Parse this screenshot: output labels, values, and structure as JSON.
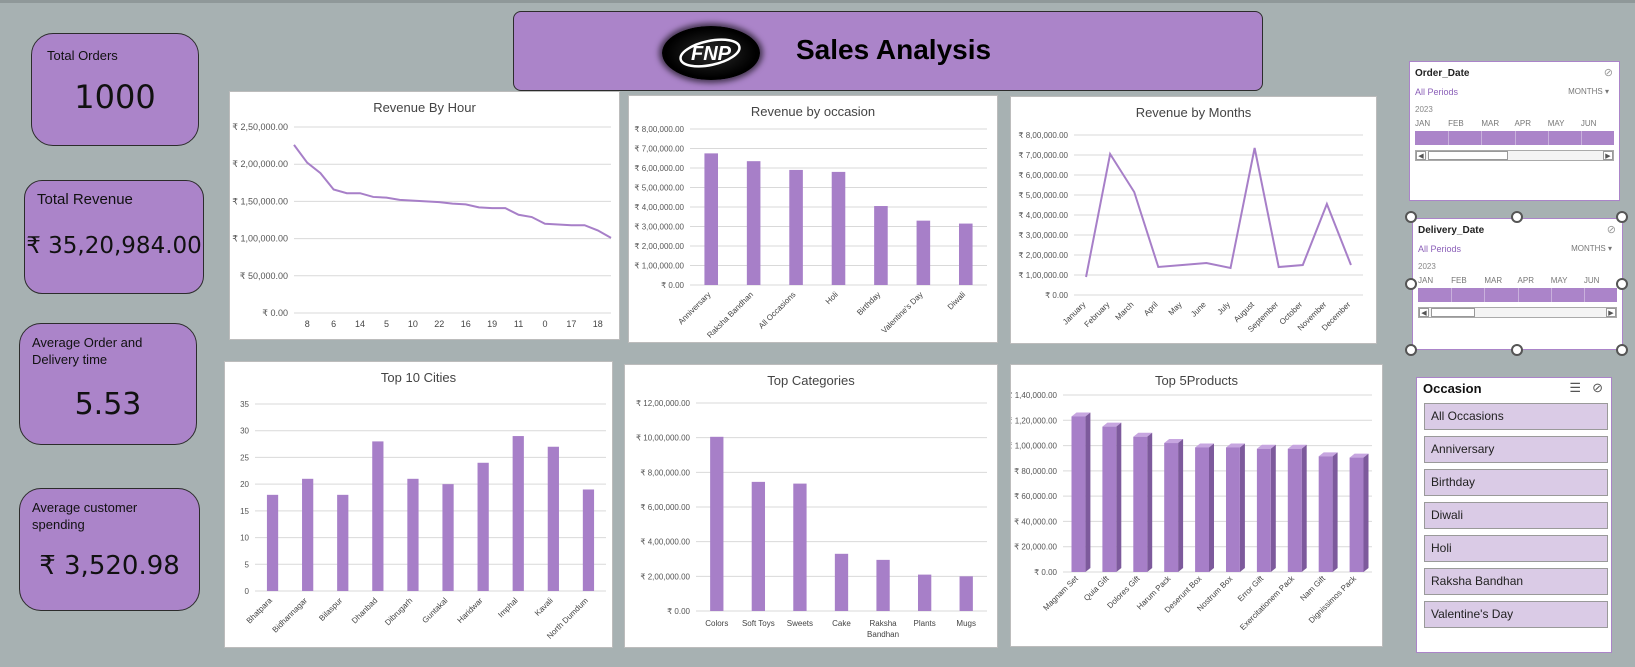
{
  "kpis": {
    "total_orders": {
      "label": "Total Orders",
      "value": "1000"
    },
    "total_revenue": {
      "label": "Total Revenue",
      "value": "₹ 35,20,984.00"
    },
    "avg_delivery": {
      "label": "Average Order and Delivery time",
      "value": "5.53"
    },
    "avg_spending": {
      "label": "Average customer spending",
      "value": "₹ 3,520.98"
    }
  },
  "banner": {
    "logo_text": "FNP",
    "title": "Sales Analysis"
  },
  "colors": {
    "accent": "#ab84c9",
    "bar": "#a77fc8",
    "background": "#a7b1b2"
  },
  "chart_data": [
    {
      "id": "hour",
      "type": "line",
      "title": "Revenue By Hour",
      "categories": [
        "8",
        "6",
        "14",
        "5",
        "10",
        "22",
        "16",
        "19",
        "11",
        "0",
        "17",
        "18"
      ],
      "values": [
        226000,
        202000,
        188000,
        166000,
        161000,
        161000,
        156000,
        155000,
        152000,
        151000,
        150000,
        149000,
        147000,
        146000,
        142000,
        141000,
        141000,
        132000,
        129000,
        120000,
        119000,
        118000,
        118000,
        111000,
        101000
      ],
      "ylim": [
        0,
        250000
      ],
      "yticks": [
        "₹ 0.00",
        "₹ 50,000.00",
        "₹ 1,00,000.00",
        "₹ 1,50,000.00",
        "₹ 2,00,000.00",
        "₹ 2,50,000.00"
      ]
    },
    {
      "id": "occasion",
      "type": "bar",
      "title": "Revenue by occasion",
      "categories": [
        "Anniversary",
        "Raksha Bandhan",
        "All Occasions",
        "Holi",
        "Birthday",
        "Valentine's Day",
        "Diwali"
      ],
      "values": [
        675000,
        635000,
        590000,
        580000,
        405000,
        330000,
        315000
      ],
      "ylim": [
        0,
        800000
      ],
      "yticks": [
        "₹ 0.00",
        "₹ 1,00,000.00",
        "₹ 2,00,000.00",
        "₹ 3,00,000.00",
        "₹ 4,00,000.00",
        "₹ 5,00,000.00",
        "₹ 6,00,000.00",
        "₹ 7,00,000.00",
        "₹ 8,00,000.00"
      ]
    },
    {
      "id": "months",
      "type": "line",
      "title": "Revenue by Months",
      "categories": [
        "January",
        "February",
        "March",
        "April",
        "May",
        "June",
        "July",
        "August",
        "September",
        "October",
        "November",
        "December"
      ],
      "values": [
        90000,
        705000,
        515000,
        140000,
        150000,
        160000,
        135000,
        735000,
        140000,
        150000,
        455000,
        150000
      ],
      "ylim": [
        0,
        800000
      ],
      "yticks": [
        "₹ 0.00",
        "₹ 1,00,000.00",
        "₹ 2,00,000.00",
        "₹ 3,00,000.00",
        "₹ 4,00,000.00",
        "₹ 5,00,000.00",
        "₹ 6,00,000.00",
        "₹ 7,00,000.00",
        "₹ 8,00,000.00"
      ]
    },
    {
      "id": "cities",
      "type": "bar",
      "title": "Top 10 Cities",
      "categories": [
        "Bhatpara",
        "Bidhannagar",
        "Bilaspur",
        "Dhanbad",
        "Dibrugarh",
        "Guntakal",
        "Haridwar",
        "Imphal",
        "Kavali",
        "North Dumdum"
      ],
      "values": [
        18,
        21,
        18,
        28,
        21,
        20,
        24,
        29,
        27,
        19
      ],
      "ylim": [
        0,
        35
      ],
      "yticks": [
        "0",
        "5",
        "10",
        "15",
        "20",
        "25",
        "30",
        "35"
      ]
    },
    {
      "id": "categories",
      "type": "bar",
      "title": "Top Categories",
      "categories": [
        "Colors",
        "Soft Toys",
        "Sweets",
        "Cake",
        "Raksha Bandhan",
        "Plants",
        "Mugs"
      ],
      "values": [
        1005000,
        745000,
        735000,
        330000,
        295000,
        210000,
        200000
      ],
      "ylim": [
        0,
        1200000
      ],
      "yticks": [
        "₹ 0.00",
        "₹ 2,00,000.00",
        "₹ 4,00,000.00",
        "₹ 6,00,000.00",
        "₹ 8,00,000.00",
        "₹ 10,00,000.00",
        "₹ 12,00,000.00"
      ]
    },
    {
      "id": "products",
      "type": "bar",
      "title": "Top 5Products",
      "categories": [
        "Magnam Set",
        "Quia Gift",
        "Dolores Gift",
        "Harum Pack",
        "Deserunt Box",
        "Nostrum Box",
        "Error Gift",
        "Exercitationem Pack",
        "Nam Gift",
        "Dignissimos Pack"
      ],
      "values": [
        123000,
        115000,
        107000,
        102000,
        98500,
        98500,
        97500,
        97500,
        91500,
        90500
      ],
      "ylim": [
        0,
        140000
      ],
      "yticks": [
        "₹ 0.00",
        "₹ 20,000.00",
        "₹ 40,000.00",
        "₹ 60,000.00",
        "₹ 80,000.00",
        "₹ 1,00,000.00",
        "₹ 1,20,000.00",
        "₹ 1,40,000.00"
      ]
    }
  ],
  "slicers": {
    "order_date": {
      "title": "Order_Date",
      "periods": "All Periods",
      "unit": "MONTHS",
      "year": "2023",
      "months": [
        "JAN",
        "FEB",
        "MAR",
        "APR",
        "MAY",
        "JUN"
      ]
    },
    "delivery_date": {
      "title": "Delivery_Date",
      "periods": "All Periods",
      "unit": "MONTHS",
      "year": "2023",
      "months": [
        "JAN",
        "FEB",
        "MAR",
        "APR",
        "MAY",
        "JUN"
      ]
    },
    "occasion": {
      "title": "Occasion",
      "items": [
        "All Occasions",
        "Anniversary",
        "Birthday",
        "Diwali",
        "Holi",
        "Raksha Bandhan",
        "Valentine's Day"
      ]
    }
  }
}
